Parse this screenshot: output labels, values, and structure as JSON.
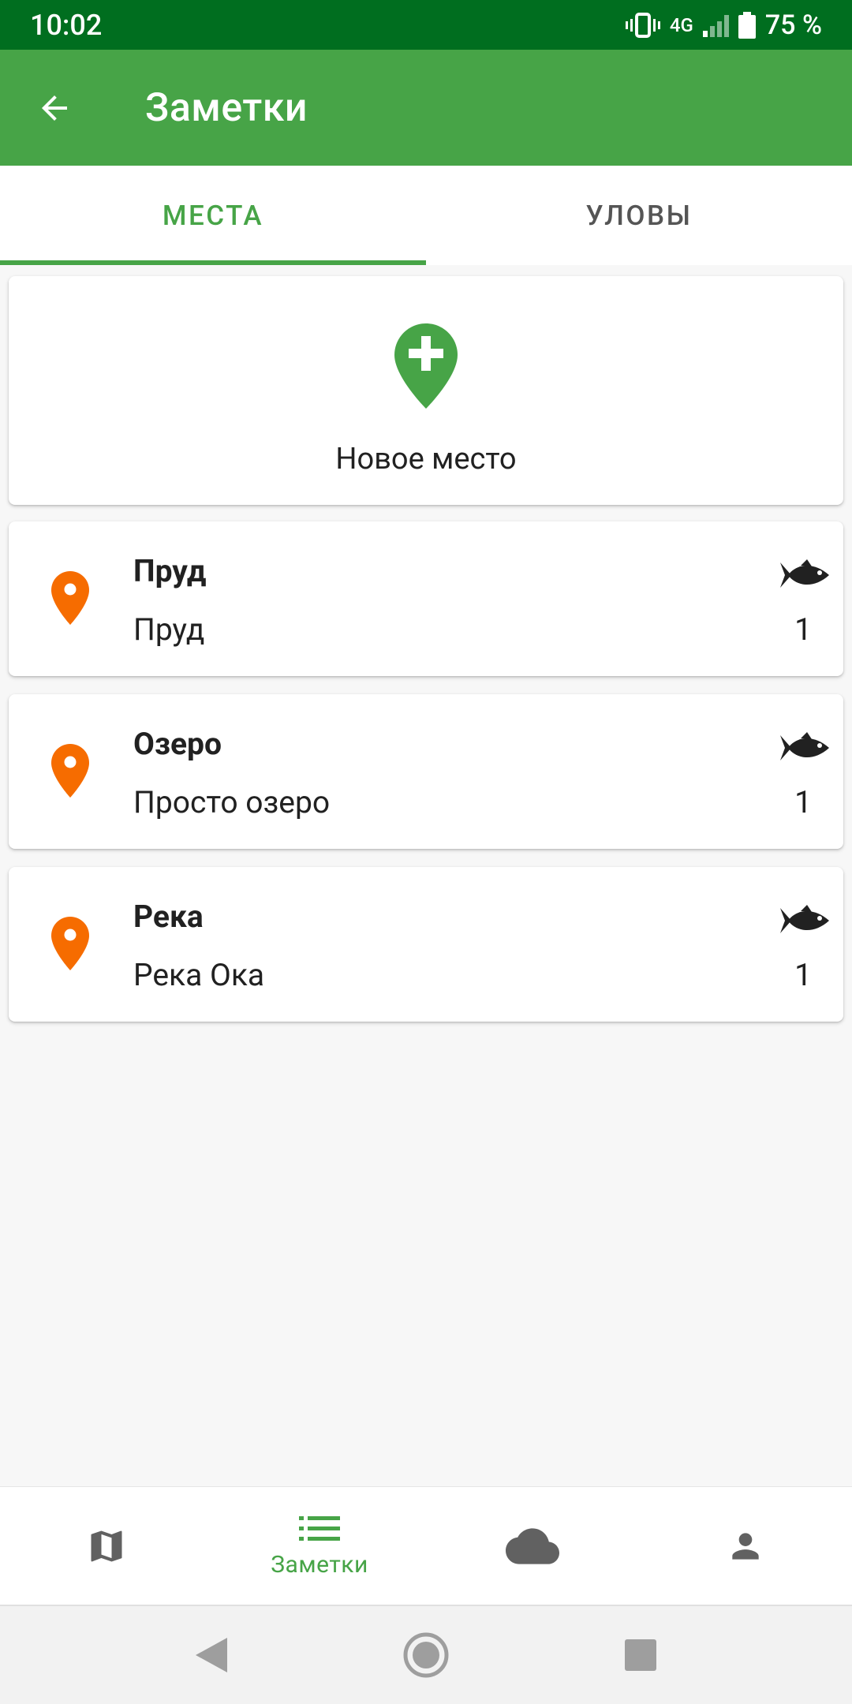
{
  "status_bar": {
    "time": "10:02",
    "network": "4G",
    "battery": "75 %"
  },
  "app_bar": {
    "title": "Заметки"
  },
  "tabs": [
    {
      "label": "МЕСТА",
      "active": true
    },
    {
      "label": "УЛОВЫ",
      "active": false
    }
  ],
  "new_place": {
    "label": "Новое место",
    "icon": "add-location-pin"
  },
  "places": [
    {
      "name": "Пруд",
      "description": "Пруд",
      "catch_count": "1",
      "icon": "location-pin",
      "catch_icon": "fish"
    },
    {
      "name": "Озеро",
      "description": "Просто озеро",
      "catch_count": "1",
      "icon": "location-pin",
      "catch_icon": "fish"
    },
    {
      "name": "Река",
      "description": "Река Ока",
      "catch_count": "1",
      "icon": "location-pin",
      "catch_icon": "fish"
    }
  ],
  "bottom_nav": {
    "items": [
      {
        "icon": "map",
        "label": "",
        "active": false
      },
      {
        "icon": "list",
        "label": "Заметки",
        "active": true
      },
      {
        "icon": "cloud",
        "label": "",
        "active": false
      },
      {
        "icon": "person",
        "label": "",
        "active": false
      }
    ]
  },
  "colors": {
    "status_bar": "#006e1f",
    "primary": "#47a447",
    "pin_orange": "#f66c00",
    "icon_gray": "#616161"
  }
}
